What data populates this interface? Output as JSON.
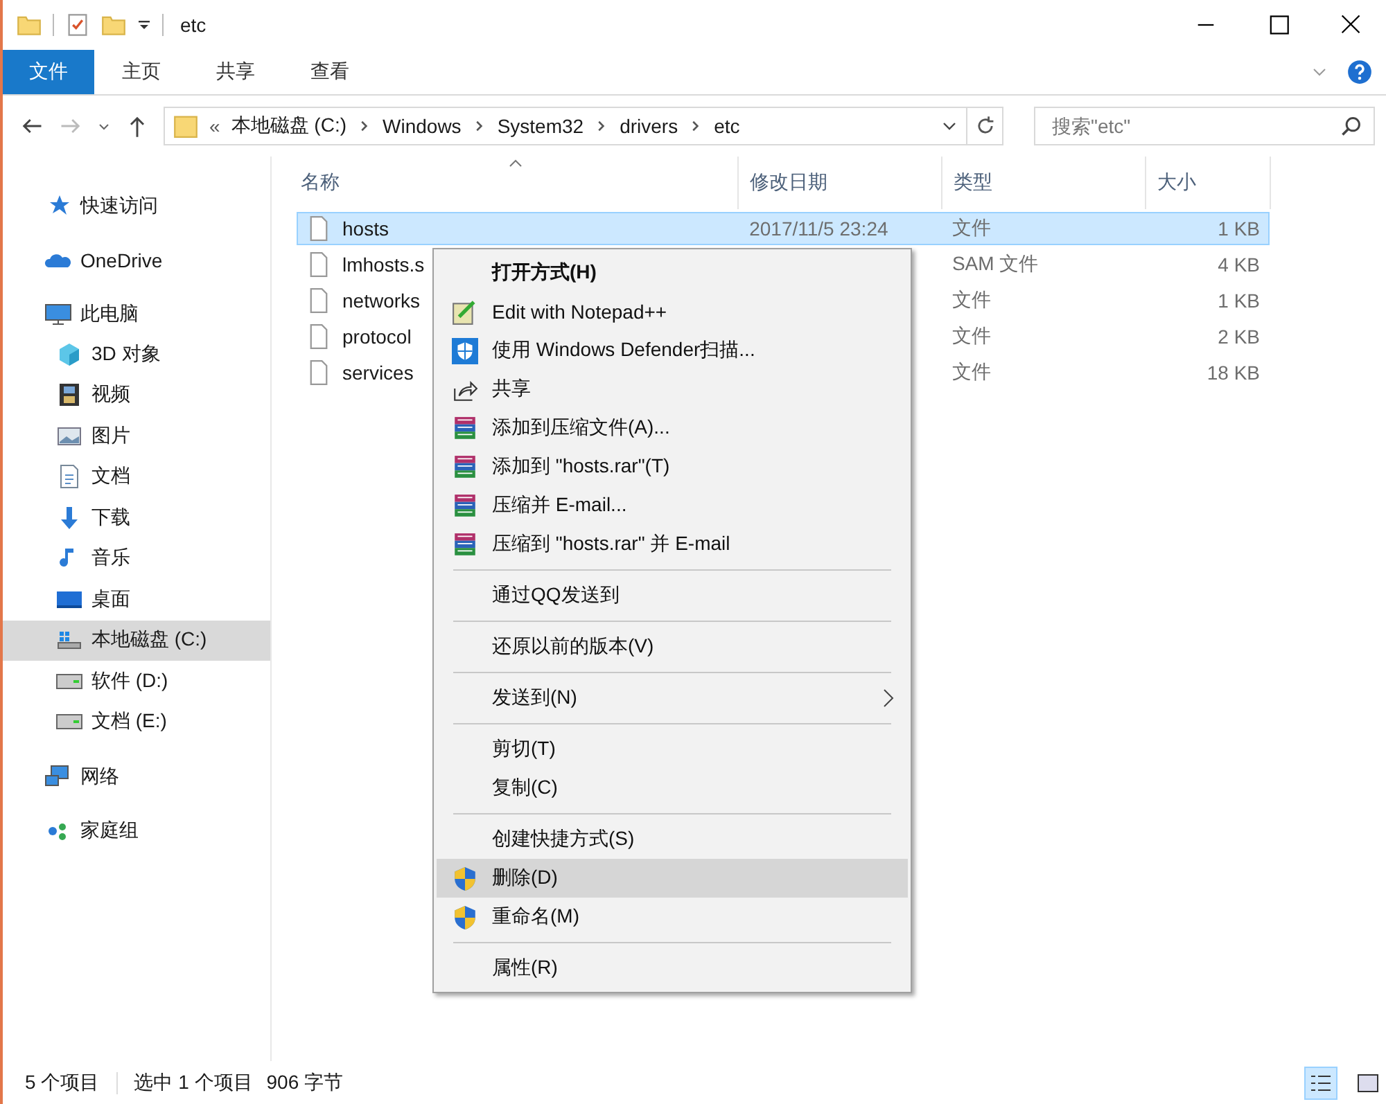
{
  "window": {
    "title": "etc"
  },
  "ribbon": {
    "tabs": [
      {
        "label": "文件",
        "selected": true
      },
      {
        "label": "主页",
        "selected": false
      },
      {
        "label": "共享",
        "selected": false
      },
      {
        "label": "查看",
        "selected": false
      }
    ]
  },
  "address": {
    "overflow": "«",
    "crumbs": [
      "本地磁盘 (C:)",
      "Windows",
      "System32",
      "drivers",
      "etc"
    ]
  },
  "search": {
    "placeholder": "搜索\"etc\""
  },
  "sidebar": {
    "items": [
      {
        "label": "快速访问",
        "kind": "star",
        "selected": false
      },
      {
        "label": "OneDrive",
        "kind": "cloud",
        "selected": false
      },
      {
        "label": "此电脑",
        "kind": "pc",
        "selected": false,
        "children": [
          {
            "label": "3D 对象",
            "kind": "cube",
            "selected": false
          },
          {
            "label": "视频",
            "kind": "film",
            "selected": false
          },
          {
            "label": "图片",
            "kind": "picture",
            "selected": false
          },
          {
            "label": "文档",
            "kind": "document",
            "selected": false
          },
          {
            "label": "下载",
            "kind": "download",
            "selected": false
          },
          {
            "label": "音乐",
            "kind": "music",
            "selected": false
          },
          {
            "label": "桌面",
            "kind": "desktop",
            "selected": false
          },
          {
            "label": "本地磁盘 (C:)",
            "kind": "sysdrive",
            "selected": true
          },
          {
            "label": "软件 (D:)",
            "kind": "drive",
            "selected": false
          },
          {
            "label": "文档 (E:)",
            "kind": "drive",
            "selected": false
          }
        ]
      },
      {
        "label": "网络",
        "kind": "network",
        "selected": false
      },
      {
        "label": "家庭组",
        "kind": "homegroup",
        "selected": false
      }
    ]
  },
  "file_list": {
    "columns": [
      "名称",
      "修改日期",
      "类型",
      "大小"
    ],
    "rows": [
      {
        "name": "hosts",
        "date": "2017/11/5 23:24",
        "type": "文件",
        "size": "1 KB",
        "selected": true
      },
      {
        "name": "lmhosts.s",
        "type": "SAM 文件",
        "size": "4 KB",
        "selected": false
      },
      {
        "name": "networks",
        "type": "文件",
        "size": "1 KB",
        "selected": false
      },
      {
        "name": "protocol",
        "type": "文件",
        "size": "2 KB",
        "selected": false
      },
      {
        "name": "services",
        "type": "文件",
        "size": "18 KB",
        "selected": false
      }
    ]
  },
  "context_menu": {
    "groups": [
      [
        {
          "label": "打开方式(H)",
          "kind": "plain",
          "default": true,
          "submenu": false,
          "selected": false
        },
        {
          "label": "Edit with Notepad++",
          "kind": "notepad",
          "default": false,
          "submenu": false,
          "selected": false
        },
        {
          "label": "使用 Windows Defender扫描...",
          "kind": "defender",
          "default": false,
          "submenu": false,
          "selected": false
        },
        {
          "label": "共享",
          "kind": "share",
          "default": false,
          "submenu": false,
          "selected": false
        },
        {
          "label": "添加到压缩文件(A)...",
          "kind": "archive",
          "default": false,
          "submenu": false,
          "selected": false
        },
        {
          "label": "添加到 \"hosts.rar\"(T)",
          "kind": "archive",
          "default": false,
          "submenu": false,
          "selected": false
        },
        {
          "label": "压缩并 E-mail...",
          "kind": "archive",
          "default": false,
          "submenu": false,
          "selected": false
        },
        {
          "label": "压缩到 \"hosts.rar\" 并 E-mail",
          "kind": "archive",
          "default": false,
          "submenu": false,
          "selected": false
        }
      ],
      [
        {
          "label": "通过QQ发送到",
          "kind": "plain",
          "default": false,
          "submenu": false,
          "selected": false
        }
      ],
      [
        {
          "label": "还原以前的版本(V)",
          "kind": "plain",
          "default": false,
          "submenu": false,
          "selected": false
        }
      ],
      [
        {
          "label": "发送到(N)",
          "kind": "plain",
          "default": false,
          "submenu": true,
          "selected": false
        }
      ],
      [
        {
          "label": "剪切(T)",
          "kind": "plain",
          "default": false,
          "submenu": false,
          "selected": false
        },
        {
          "label": "复制(C)",
          "kind": "plain",
          "default": false,
          "submenu": false,
          "selected": false
        }
      ],
      [
        {
          "label": "创建快捷方式(S)",
          "kind": "plain",
          "default": false,
          "submenu": false,
          "selected": false
        },
        {
          "label": "删除(D)",
          "kind": "uac",
          "default": false,
          "submenu": false,
          "selected": true
        },
        {
          "label": "重命名(M)",
          "kind": "uac",
          "default": false,
          "submenu": false,
          "selected": false
        }
      ],
      [
        {
          "label": "属性(R)",
          "kind": "plain",
          "default": false,
          "submenu": false,
          "selected": false
        }
      ]
    ]
  },
  "status_bar": {
    "count": "5 个项目",
    "selection": "选中 1 个项目",
    "size": "906 字节"
  }
}
